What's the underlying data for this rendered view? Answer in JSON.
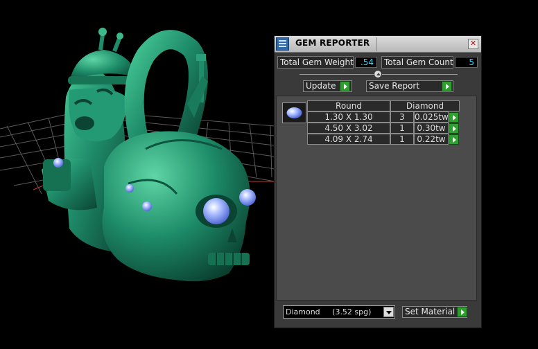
{
  "panel": {
    "title": "GEM REPORTER",
    "close_glyph": "✕",
    "icons": {
      "app": "gem-reporter-icon",
      "close": "close-icon"
    }
  },
  "stats": {
    "weight_label": "Total Gem Weight",
    "weight_value": ".54",
    "count_label": "Total Gem Count",
    "count_value": "5"
  },
  "actions": {
    "update_label": "Update",
    "save_label": "Save Report",
    "set_material_label": "Set Material"
  },
  "report": {
    "headers": [
      "Round",
      "Diamond"
    ],
    "rows": [
      {
        "size": "1.30 X 1.30",
        "count": "3",
        "weight": "0.025tw"
      },
      {
        "size": "4.50 X 3.02",
        "count": "1",
        "weight": "0.30tw"
      },
      {
        "size": "4.09 X 2.74",
        "count": "1",
        "weight": "0.22tw"
      }
    ]
  },
  "material": {
    "selected": "Diamond     (3.52 spg)"
  },
  "colors": {
    "model_green": "#1f8c6a",
    "value_text": "#39d5ff",
    "go_button": "#2fa02f",
    "gem_blue": "#9db4ff"
  }
}
